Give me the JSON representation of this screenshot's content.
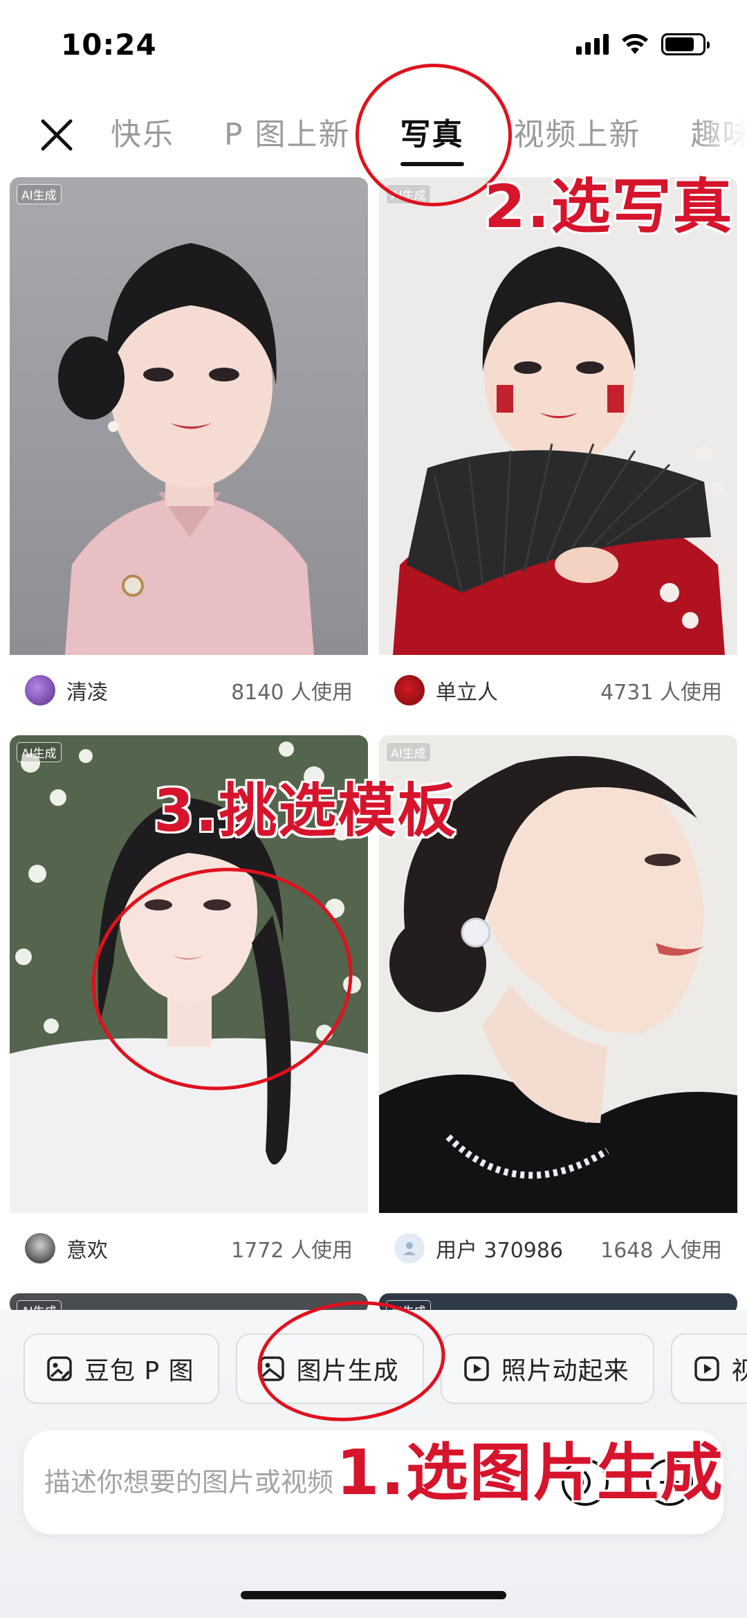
{
  "status_bar": {
    "time": "10:24"
  },
  "tabs": [
    {
      "label": "快乐",
      "active": false
    },
    {
      "label": "P 图上新",
      "active": false
    },
    {
      "label": "写真",
      "active": true
    },
    {
      "label": "视频上新",
      "active": false
    },
    {
      "label": "趣味",
      "active": false
    }
  ],
  "cards": [
    {
      "badge": "AI生成",
      "author": "清凌",
      "uses": "8140 人使用"
    },
    {
      "badge": "AI生成",
      "author": "单立人",
      "uses": "4731 人使用"
    },
    {
      "badge": "AI生成",
      "author": "意欢",
      "uses": "1772 人使用"
    },
    {
      "badge": "AI生成",
      "author": "用户 370986",
      "uses": "1648 人使用"
    },
    {
      "badge": "AI生成"
    },
    {
      "badge": "AI生成"
    }
  ],
  "chips": [
    {
      "label": "豆包 P 图",
      "icon": "image-edit-icon"
    },
    {
      "label": "图片生成",
      "icon": "image-icon"
    },
    {
      "label": "照片动起来",
      "icon": "play-icon"
    },
    {
      "label": "视",
      "icon": "play-icon"
    }
  ],
  "input": {
    "placeholder": "描述你想要的图片或视频"
  },
  "annotations": {
    "step1": "1.选图片生成",
    "step2": "2.选写真",
    "step3": "3.挑选模板"
  },
  "colors": {
    "annotation_red": "#d6142b",
    "active_tab": "#111111"
  }
}
